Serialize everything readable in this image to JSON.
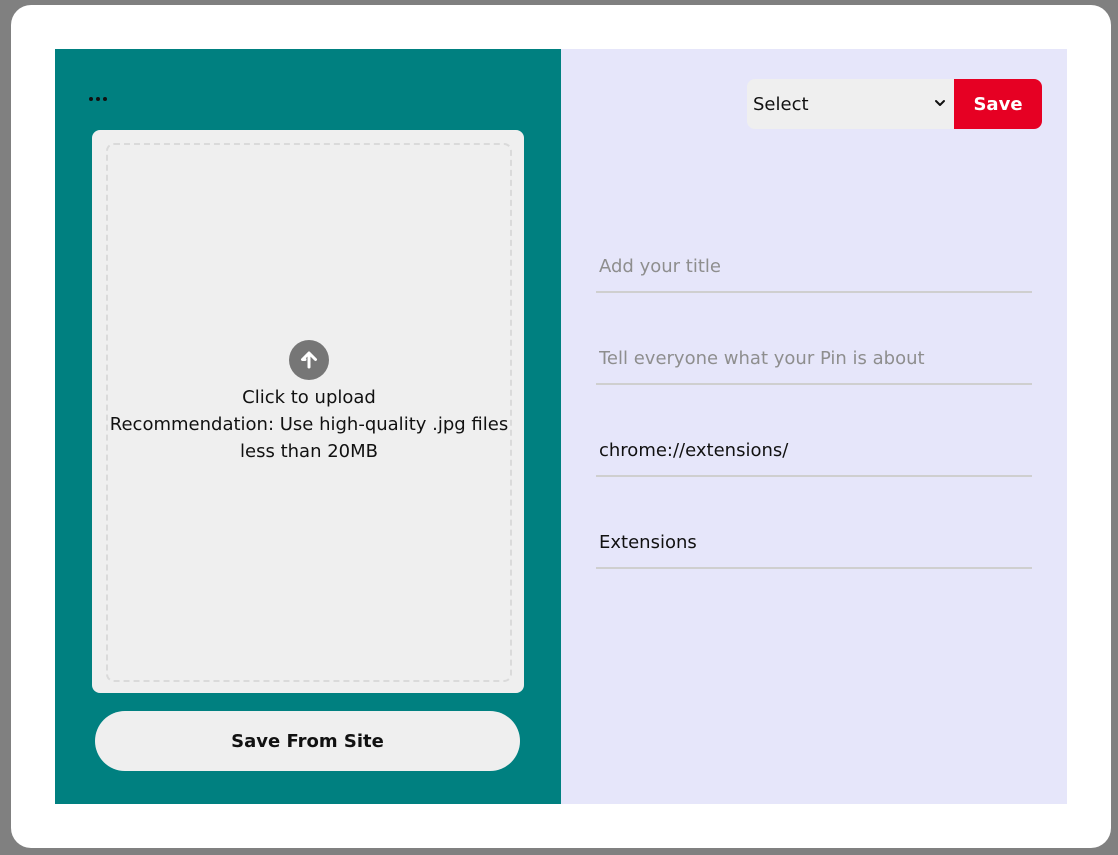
{
  "left_panel": {
    "more_icon": "more-horizontal-icon",
    "upload": {
      "icon": "arrow-up-circle-icon",
      "line1": "Click to upload",
      "line2": "Recommendation: Use high-quality .jpg files",
      "line3": "less than 20MB"
    },
    "save_from_site_label": "Save From Site"
  },
  "right_panel": {
    "board_select": {
      "selected": "Select",
      "icon": "chevron-down-icon"
    },
    "save_label": "Save",
    "fields": {
      "title": {
        "value": "",
        "placeholder": "Add your title"
      },
      "description": {
        "value": "",
        "placeholder": "Tell everyone what your Pin is about"
      },
      "link": {
        "value": "chrome://extensions/",
        "placeholder": ""
      },
      "site_name": {
        "value": "Extensions",
        "placeholder": ""
      }
    }
  },
  "colors": {
    "overlay": "#808080",
    "left_bg": "#008080",
    "right_bg": "#e6e6fa",
    "save_button": "#e60023",
    "card_bg": "#efefef"
  }
}
